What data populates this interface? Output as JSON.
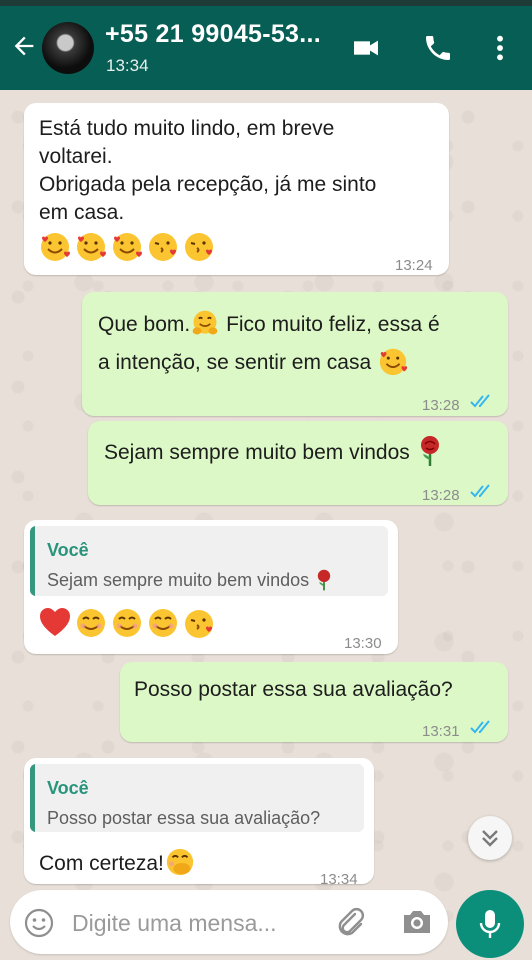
{
  "header": {
    "contact_name": "+55 21 99045-53...",
    "last_seen": "13:34"
  },
  "messages": [
    {
      "direction": "in",
      "lines": [
        "Está tudo muito lindo, em breve",
        "voltarei.",
        "Obrigada pela recepção, já me sinto",
        "em casa."
      ],
      "emojis": [
        "smiling-face-with-hearts",
        "smiling-face-with-hearts",
        "smiling-face-with-hearts",
        "face-blowing-kiss",
        "face-blowing-kiss"
      ],
      "time": "13:24"
    },
    {
      "direction": "out",
      "lines": [
        "Que bom.",
        "Fico muito feliz, essa é",
        "a intenção, se sentir em casa"
      ],
      "time": "13:28",
      "status": "read"
    },
    {
      "direction": "out",
      "lines": [
        "Sejam sempre muito bem vindos"
      ],
      "time": "13:28",
      "status": "read"
    },
    {
      "direction": "in",
      "quote_author": "Você",
      "quote_text": "Sejam sempre muito bem vindos",
      "emojis": [
        "red-heart",
        "smiling-face",
        "smiling-face",
        "smiling-face",
        "face-blowing-kiss"
      ],
      "time": "13:30"
    },
    {
      "direction": "out",
      "lines": [
        "Posso postar essa sua avaliação?"
      ],
      "time": "13:31",
      "status": "read"
    },
    {
      "direction": "in",
      "quote_author": "Você",
      "quote_text": "Posso postar essa sua avaliação?",
      "lines": [
        "Com certeza!"
      ],
      "time": "13:34"
    }
  ],
  "composer": {
    "placeholder": "Digite uma mensa..."
  },
  "colors": {
    "header": "#075e54",
    "incoming_bubble": "#ffffff",
    "outgoing_bubble": "#dcf8c6",
    "read_ticks": "#34b7f1",
    "quote_accent": "#35977e",
    "fab": "#0b8f7b"
  }
}
